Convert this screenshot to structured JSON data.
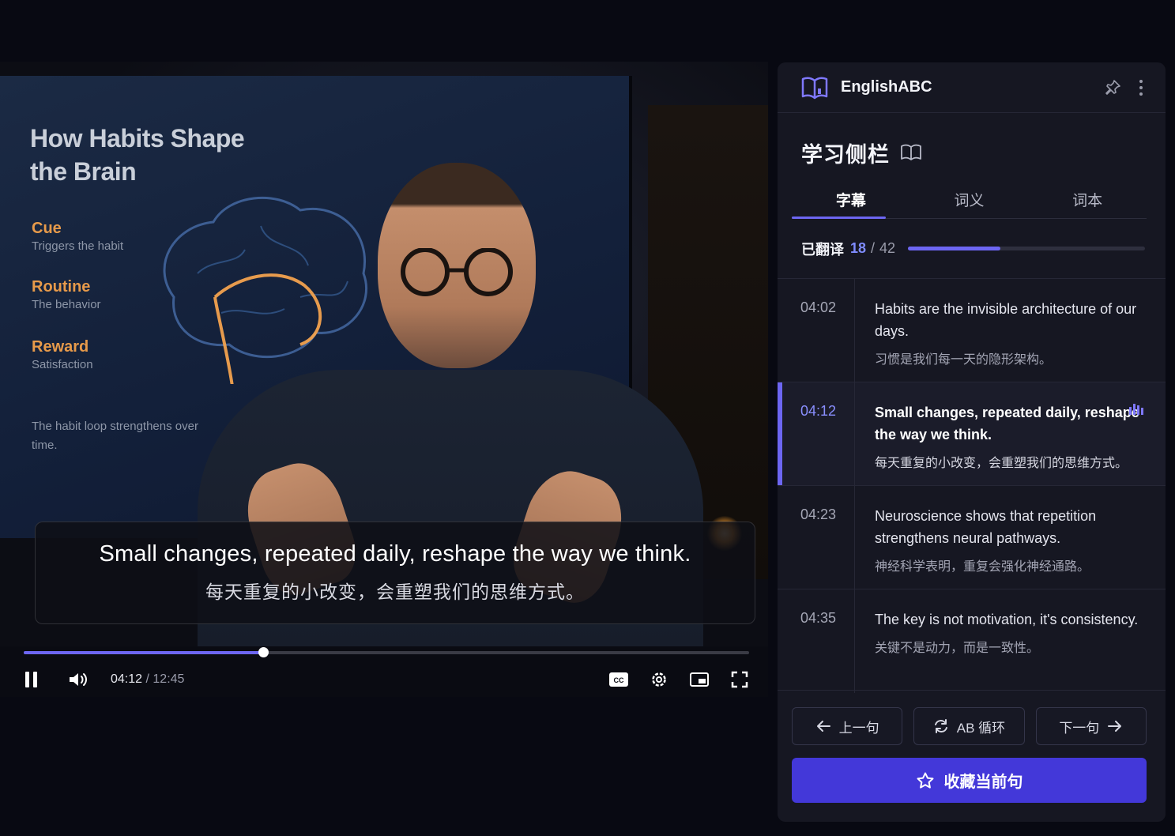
{
  "video": {
    "slide": {
      "title": "How Habits Shape the Brain",
      "loop": [
        {
          "key": "Cue",
          "value": "Triggers the habit"
        },
        {
          "key": "Routine",
          "value": "The behavior"
        },
        {
          "key": "Reward",
          "value": "Satisfaction"
        }
      ],
      "footnote": "The habit loop strengthens over time."
    },
    "subtitle": {
      "en": "Small changes, repeated daily, reshape the way we think.",
      "zh": "每天重复的小改变，会重塑我们的思维方式。"
    },
    "progress_fraction": 0.33,
    "current_time": "04:12",
    "separator": "/",
    "total_time": "12:45",
    "icons": [
      "pause-icon",
      "volume-icon",
      "cc-icon",
      "settings-icon",
      "pip-icon",
      "fullscreen-icon"
    ]
  },
  "sidebar": {
    "app_name": "EnglishABC",
    "title": "学习侧栏",
    "tabs": [
      {
        "label": "字幕",
        "active": true
      },
      {
        "label": "词义",
        "active": false
      },
      {
        "label": "词本",
        "active": false
      }
    ],
    "progress": {
      "label": "已翻译",
      "done": "18",
      "separator": "/",
      "total": "42",
      "fraction": 0.39
    },
    "cues": [
      {
        "time": "04:02",
        "en": "Habits are the invisible architecture of our days.",
        "zh": "习惯是我们每一天的隐形架构。",
        "active": false
      },
      {
        "time": "04:12",
        "en": "Small changes, repeated daily, reshape the way we think.",
        "zh": "每天重复的小改变，会重塑我们的思维方式。",
        "active": true
      },
      {
        "time": "04:23",
        "en": "Neuroscience shows that repetition strengthens neural pathways.",
        "zh": "神经科学表明，重复会强化神经通路。",
        "active": false
      },
      {
        "time": "04:35",
        "en": "The key is not motivation, it's consistency.",
        "zh": "关键不是动力，而是一致性。",
        "active": false
      }
    ],
    "buttons": {
      "prev": "上一句",
      "loop": "AB 循环",
      "next": "下一句",
      "favorite": "收藏当前句"
    },
    "accent_color": "#6d66f2",
    "button_color": "#4338d9"
  }
}
